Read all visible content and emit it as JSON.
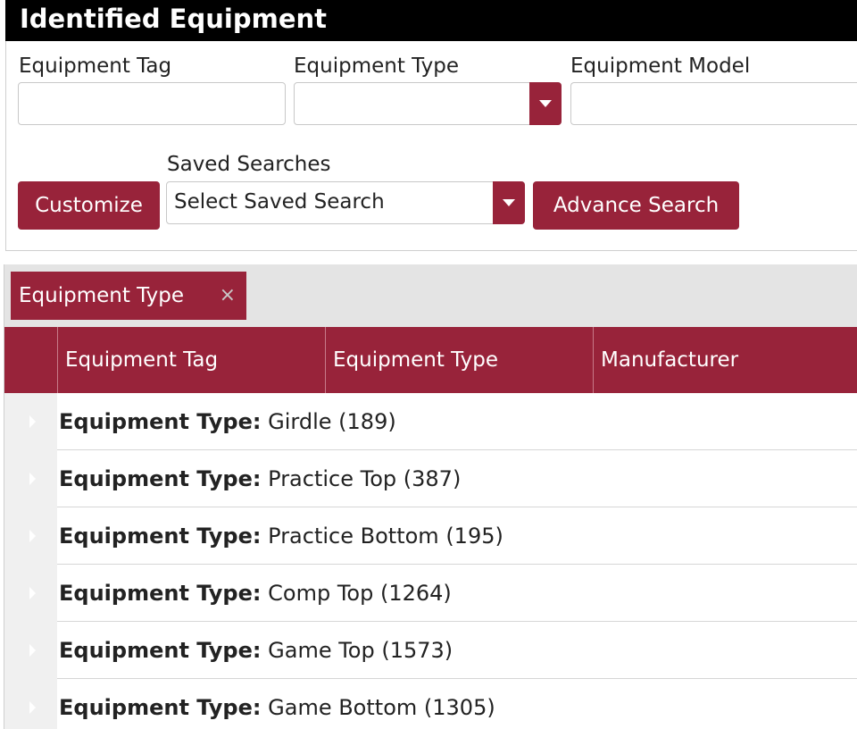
{
  "title": "Identified Equipment",
  "filters": {
    "equipment_tag": {
      "label": "Equipment Tag",
      "value": ""
    },
    "equipment_type": {
      "label": "Equipment Type",
      "value": ""
    },
    "equipment_model": {
      "label": "Equipment Model",
      "value": ""
    }
  },
  "saved_searches": {
    "label": "Saved Searches",
    "selected": "Select Saved Search"
  },
  "buttons": {
    "customize": "Customize",
    "advance_search": "Advance Search"
  },
  "grouping": {
    "chip_label": "Equipment Type",
    "chip_close": "×"
  },
  "columns": [
    "Equipment Tag",
    "Equipment Type",
    "Manufacturer"
  ],
  "groups": [
    {
      "label": "Equipment Type:",
      "name": "Girdle",
      "count": "(189)"
    },
    {
      "label": "Equipment Type:",
      "name": "Practice Top",
      "count": "(387)"
    },
    {
      "label": "Equipment Type:",
      "name": "Practice Bottom",
      "count": "(195)"
    },
    {
      "label": "Equipment Type:",
      "name": "Comp Top",
      "count": "(1264)"
    },
    {
      "label": "Equipment Type:",
      "name": "Game Top",
      "count": "(1573)"
    },
    {
      "label": "Equipment Type:",
      "name": "Game Bottom",
      "count": "(1305)"
    }
  ],
  "colors": {
    "accent": "#98233a",
    "header_bg": "#000000",
    "group_bar_bg": "#e4e4e4"
  }
}
